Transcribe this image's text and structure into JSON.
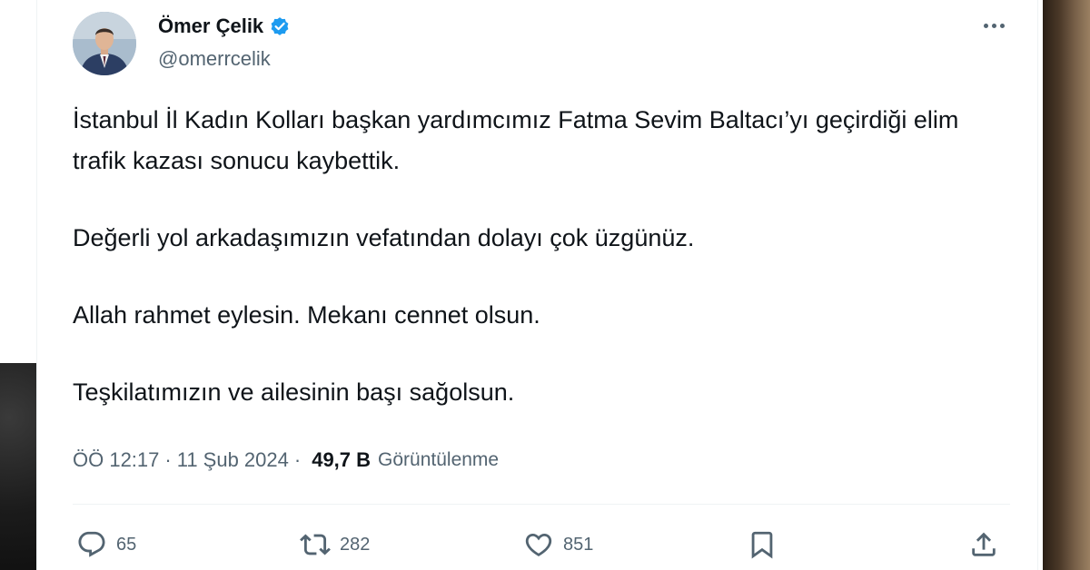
{
  "tweet": {
    "author": {
      "name": "Ömer Çelik",
      "handle": "@omerrcelik",
      "verified": true
    },
    "paragraphs": [
      "İstanbul İl Kadın Kolları başkan yardımcımız Fatma Sevim Baltacı’yı geçirdiği elim trafik kazası sonucu kaybettik.",
      "Değerli yol arkadaşımızın vefatından dolayı çok üzgünüz.",
      "Allah rahmet eylesin. Mekanı cennet olsun.",
      "Teşkilatımızın ve ailesinin başı sağolsun."
    ],
    "meta": {
      "time": "ÖÖ 12:17",
      "date": "11 Şub 2024",
      "separator": "·",
      "views_count": "49,7 B",
      "views_label": "Görüntülenme"
    },
    "actions": {
      "replies": "65",
      "reposts": "282",
      "likes": "851"
    }
  },
  "colors": {
    "text_primary": "#0f1419",
    "text_secondary": "#536471",
    "verified_blue": "#1d9bf0",
    "divider": "#eff3f4"
  },
  "icons": [
    "verified-badge-icon",
    "more-options-icon",
    "reply-icon",
    "repost-icon",
    "like-icon",
    "bookmark-icon",
    "share-icon"
  ]
}
